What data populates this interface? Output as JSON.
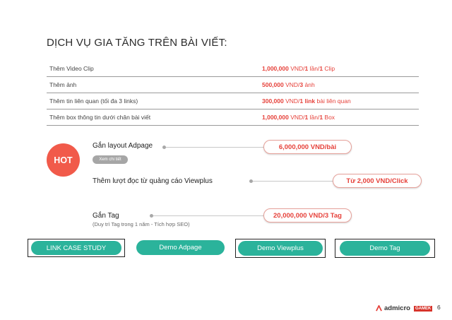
{
  "title": "DỊCH VỤ GIA TĂNG TRÊN BÀI VIẾT:",
  "table_rows": [
    {
      "name": "Thêm Video Clip",
      "price_num": "1,000,000",
      "price_unit": " VND/",
      "price_num2": "1",
      "price_rest": " lần/",
      "price_num3": "1",
      "price_tail": " Clip"
    },
    {
      "name": "Thêm ảnh",
      "price_num": "500,000",
      "price_unit": " VND/",
      "price_num2": "3",
      "price_rest": " ảnh",
      "price_num3": "",
      "price_tail": ""
    },
    {
      "name": "Thêm tin liên quan (tối đa 3 links)",
      "price_num": "300,000",
      "price_unit": " VND/",
      "price_num2": "1 link",
      "price_rest": " bài liên quan",
      "price_num3": "",
      "price_tail": ""
    },
    {
      "name": "Thêm box thông tin dưới chân bài viết",
      "price_num": "1,000,000",
      "price_unit": " VND/",
      "price_num2": "1",
      "price_rest": " lần/",
      "price_num3": "1",
      "price_tail": " Box"
    }
  ],
  "hot_badge": "HOT",
  "features": {
    "adpage": {
      "label": "Gắn layout Adpage",
      "detail": "Xem chi tiết",
      "price": "6,000,000 VND/bài"
    },
    "viewplus": {
      "label": "Thêm lượt đọc từ quảng cáo Viewplus",
      "price": "Từ 2,000 VND/Click"
    },
    "tag": {
      "label": "Gắn Tag",
      "sub": "(Duy trì Tag trong 1 năm - Tích hợp SEO)",
      "price": "20,000,000 VND/3 Tag"
    }
  },
  "buttons": {
    "case_study": "LINK CASE STUDY",
    "demo_adpage": "Demo Adpage",
    "demo_viewplus": "Demo Viewplus",
    "demo_tag": "Demo Tag"
  },
  "footer": {
    "brand": "admicro",
    "partner": "GAMEK",
    "page_number": "6"
  },
  "colors": {
    "accent_red": "#e6413a",
    "button_teal": "#2bb39b",
    "hot_red": "#f15a4a"
  }
}
